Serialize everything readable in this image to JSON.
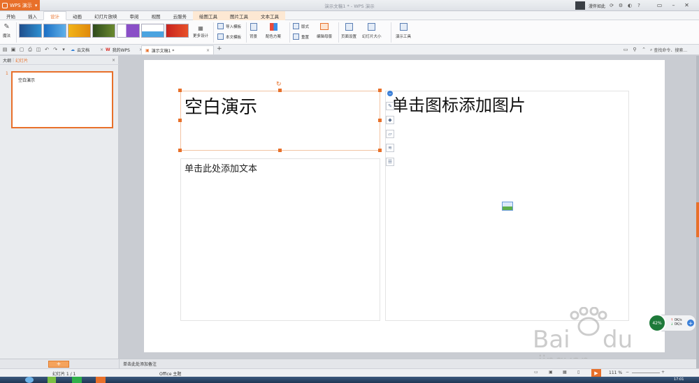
{
  "title_bar": {
    "app_menu_label": "WPS 演示",
    "window_title": "演示文稿1 * - WPS 演示",
    "user_name": "漫伴如此"
  },
  "menu_tabs": [
    {
      "label": "开始"
    },
    {
      "label": "插入"
    },
    {
      "label": "设计"
    },
    {
      "label": "动画"
    },
    {
      "label": "幻灯片放映"
    },
    {
      "label": "审阅"
    },
    {
      "label": "视图"
    },
    {
      "label": "云服务"
    },
    {
      "label": "绘图工具"
    },
    {
      "label": "图片工具"
    },
    {
      "label": "文本工具"
    }
  ],
  "ribbon": {
    "magic_label": "魔法",
    "more_designs_label": "更多设计",
    "import_template_label": "导入模板",
    "this_template_label": "本文模板",
    "background_label": "背景",
    "color_scheme_label": "配色方案",
    "layout_label": "版式",
    "reset_label": "重置",
    "edit_master_label": "编辑母版",
    "page_setup_label": "页面设置",
    "slide_size_label": "幻灯片大小",
    "presentation_tools_label": "演示工具"
  },
  "quick_access": {
    "tabs": [
      {
        "label": "云文档",
        "active": false
      },
      {
        "label": "我的WPS",
        "active": false
      },
      {
        "label": "演示文稿1 *",
        "active": true
      }
    ],
    "search_placeholder": "查找命令、搜索..."
  },
  "left_panel": {
    "tab_outline": "大纲",
    "tab_slides": "幻灯片",
    "thumbnail_number": "1",
    "thumbnail_title": "空白演示"
  },
  "slide": {
    "title_text": "空白演示",
    "body_placeholder": "单击此处添加文本",
    "picture_placeholder": "单击图标添加图片"
  },
  "notes": {
    "placeholder": "单击此处添加备注"
  },
  "status_bar": {
    "slide_counter": "幻灯片 1 / 1",
    "theme": "Office 主题",
    "zoom": "111 %"
  },
  "speed_widget": {
    "percent": "42%",
    "up": "0K/s",
    "down": "0K/s"
  },
  "taskbar": {
    "time": "17:01"
  },
  "colors": {
    "accent": "#e8702a",
    "selection": "#e8702a"
  }
}
